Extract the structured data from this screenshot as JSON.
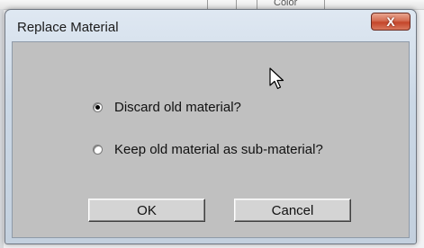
{
  "dialog": {
    "title": "Replace Material",
    "close_icon": "close-icon",
    "close_glyph": "X"
  },
  "background": {
    "partial_label": "Color"
  },
  "options": [
    {
      "label": "Discard old material?",
      "selected": true
    },
    {
      "label": "Keep old material as sub-material?",
      "selected": false
    }
  ],
  "buttons": {
    "ok_label": "OK",
    "cancel_label": "Cancel"
  },
  "colors": {
    "close_button": "#c4452a",
    "client_background": "#c0c0c0"
  }
}
